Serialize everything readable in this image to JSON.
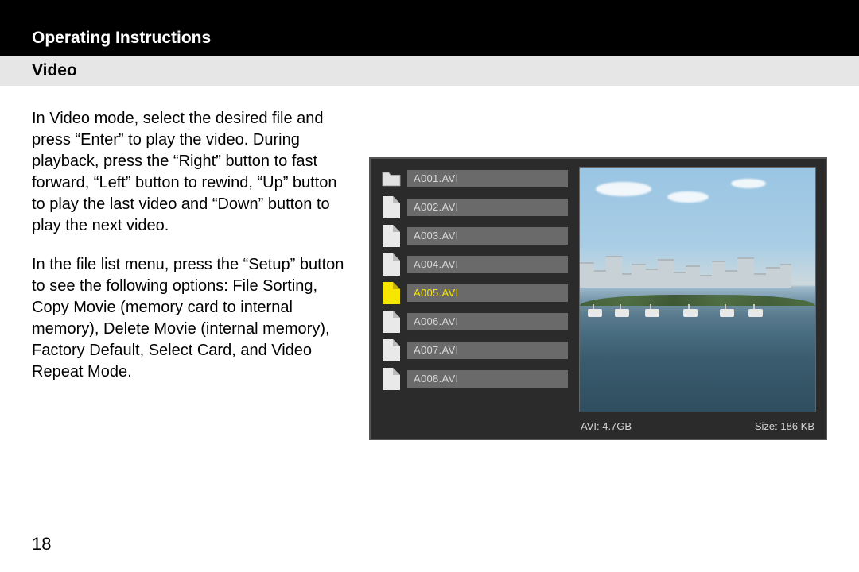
{
  "header": {
    "title": "Operating Instructions"
  },
  "subheader": {
    "title": "Video"
  },
  "body": {
    "p1": "In Video mode, select the desired file and press “Enter” to play the video. During playback, press the “Right” button to fast forward, “Left” button to rewind, “Up” button to play the last video and “Down” button to play the next video.",
    "p2": "In the file list menu, press the “Setup” button to see the following options: File Sorting, Copy Movie (memory card to internal memory), Delete Movie (internal memory), Factory Default, Select Card, and Video Repeat Mode."
  },
  "device": {
    "files": [
      {
        "name": "A001.AVI",
        "type": "folder",
        "selected": false
      },
      {
        "name": "A002.AVI",
        "type": "file",
        "selected": false
      },
      {
        "name": "A003.AVI",
        "type": "file",
        "selected": false
      },
      {
        "name": "A004.AVI",
        "type": "file",
        "selected": false
      },
      {
        "name": "A005.AVI",
        "type": "file",
        "selected": true
      },
      {
        "name": "A006.AVI",
        "type": "file",
        "selected": false
      },
      {
        "name": "A007.AVI",
        "type": "file",
        "selected": false
      },
      {
        "name": "A008.AVI",
        "type": "file",
        "selected": false
      }
    ],
    "info": {
      "left": "AVI: 4.7GB",
      "right": "Size: 186 KB"
    }
  },
  "page_number": "18"
}
